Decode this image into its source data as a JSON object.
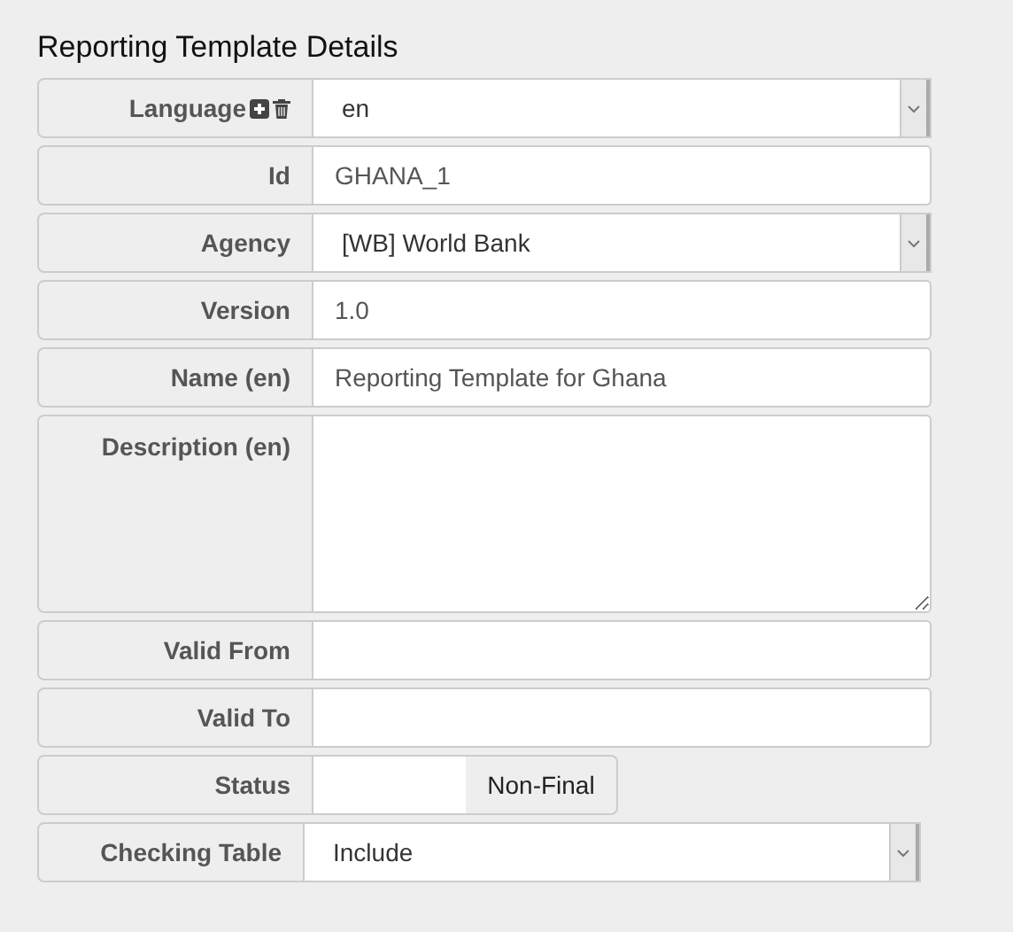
{
  "title": "Reporting Template Details",
  "fields": [
    {
      "kind": "select",
      "label": "Language",
      "icons": true,
      "value": "en"
    },
    {
      "kind": "text",
      "label": "Id",
      "value": "GHANA_1"
    },
    {
      "kind": "select",
      "label": "Agency",
      "value": "[WB] World Bank"
    },
    {
      "kind": "text",
      "label": "Version",
      "value": "1.0"
    },
    {
      "kind": "text",
      "label": "Name (en)",
      "value": "Reporting Template for Ghana"
    },
    {
      "kind": "textarea",
      "label": "Description (en)"
    },
    {
      "kind": "text",
      "label": "Valid From"
    },
    {
      "kind": "text",
      "label": "Valid To"
    },
    {
      "kind": "toggle",
      "label": "Status",
      "on": false,
      "value": "Non-Final"
    },
    {
      "kind": "select",
      "label": "Checking Table",
      "value": "Include",
      "narrow": true
    }
  ]
}
